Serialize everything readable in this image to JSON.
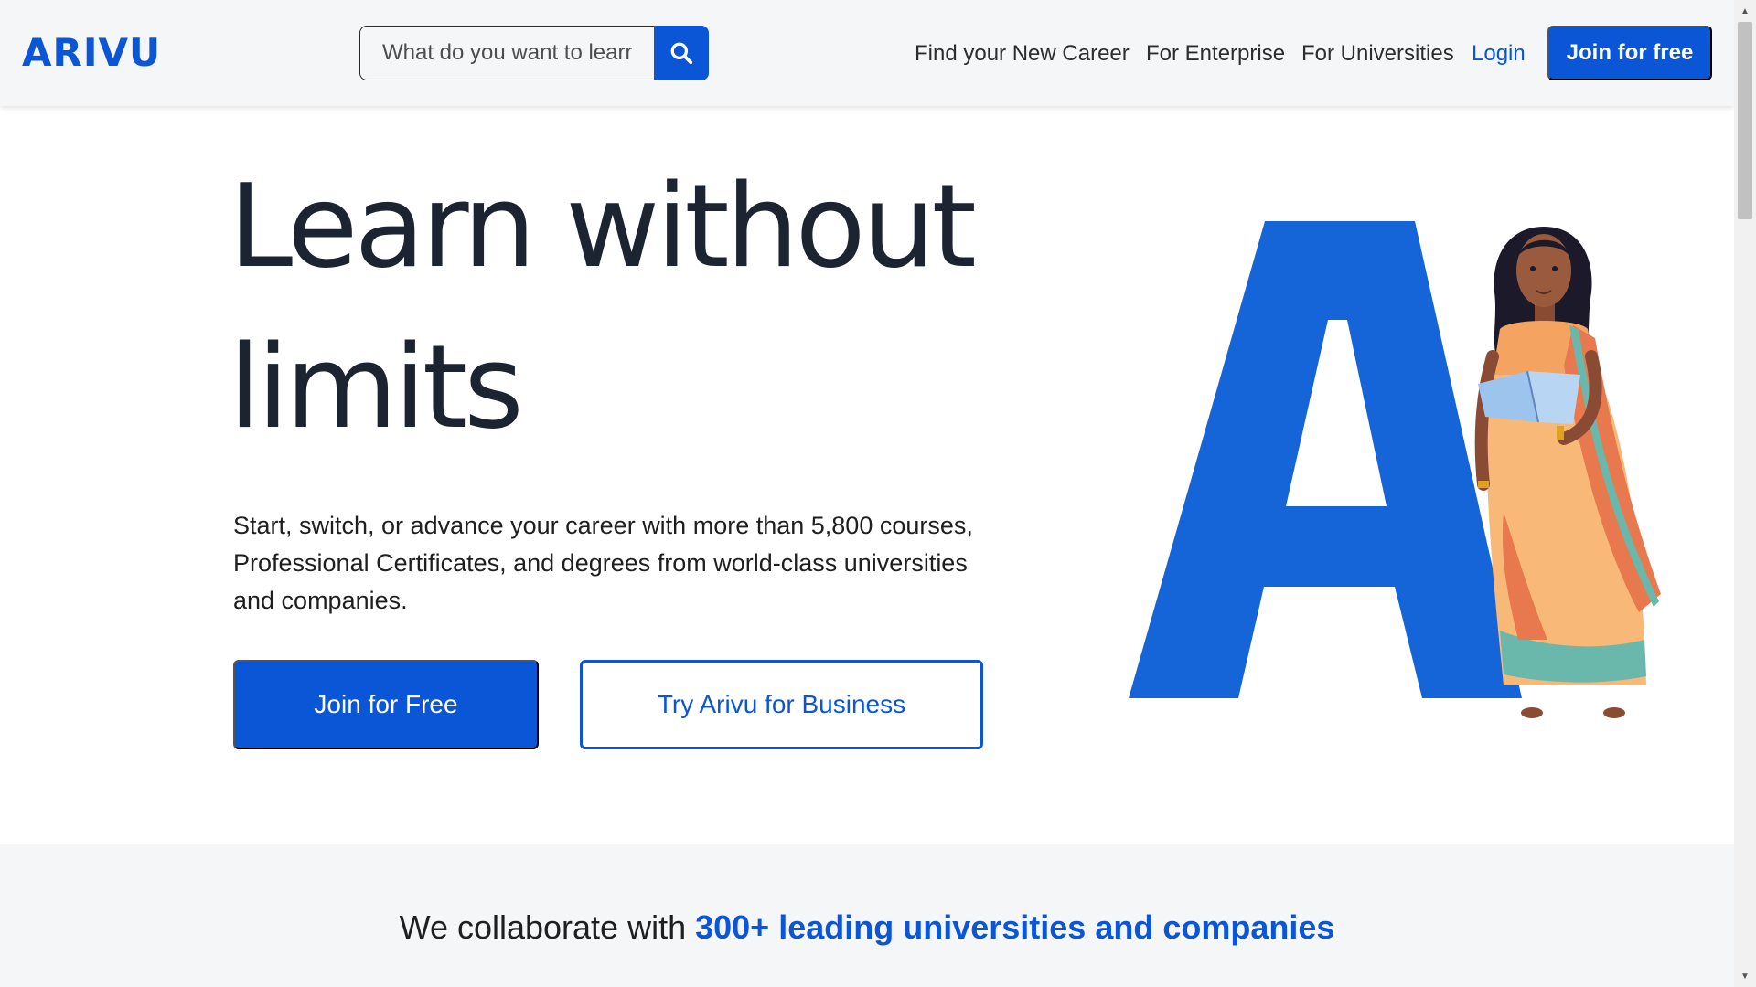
{
  "header": {
    "logo": "ARIVU",
    "search": {
      "placeholder": "What do you want to learn?",
      "icon": "search-icon"
    },
    "nav": [
      {
        "label": "Find your New Career"
      },
      {
        "label": "For Enterprise"
      },
      {
        "label": "For Universities"
      },
      {
        "label": "Login"
      }
    ],
    "join_label": "Join for free"
  },
  "hero": {
    "title_line1": "Learn without",
    "title_line2": "limits",
    "description": "Start, switch, or advance your career with more than 5,800 courses, Professional Certificates, and degrees from world-class universities and companies.",
    "primary_cta": "Join for Free",
    "secondary_cta": "Try Arivu for Business",
    "illustration_letter": "A"
  },
  "partners": {
    "prefix": "We collaborate with ",
    "highlight": "300+ leading universities and companies"
  },
  "colors": {
    "brand": "#0a56d6",
    "header_bg": "#f5f6f7",
    "heading": "#1c2331"
  }
}
